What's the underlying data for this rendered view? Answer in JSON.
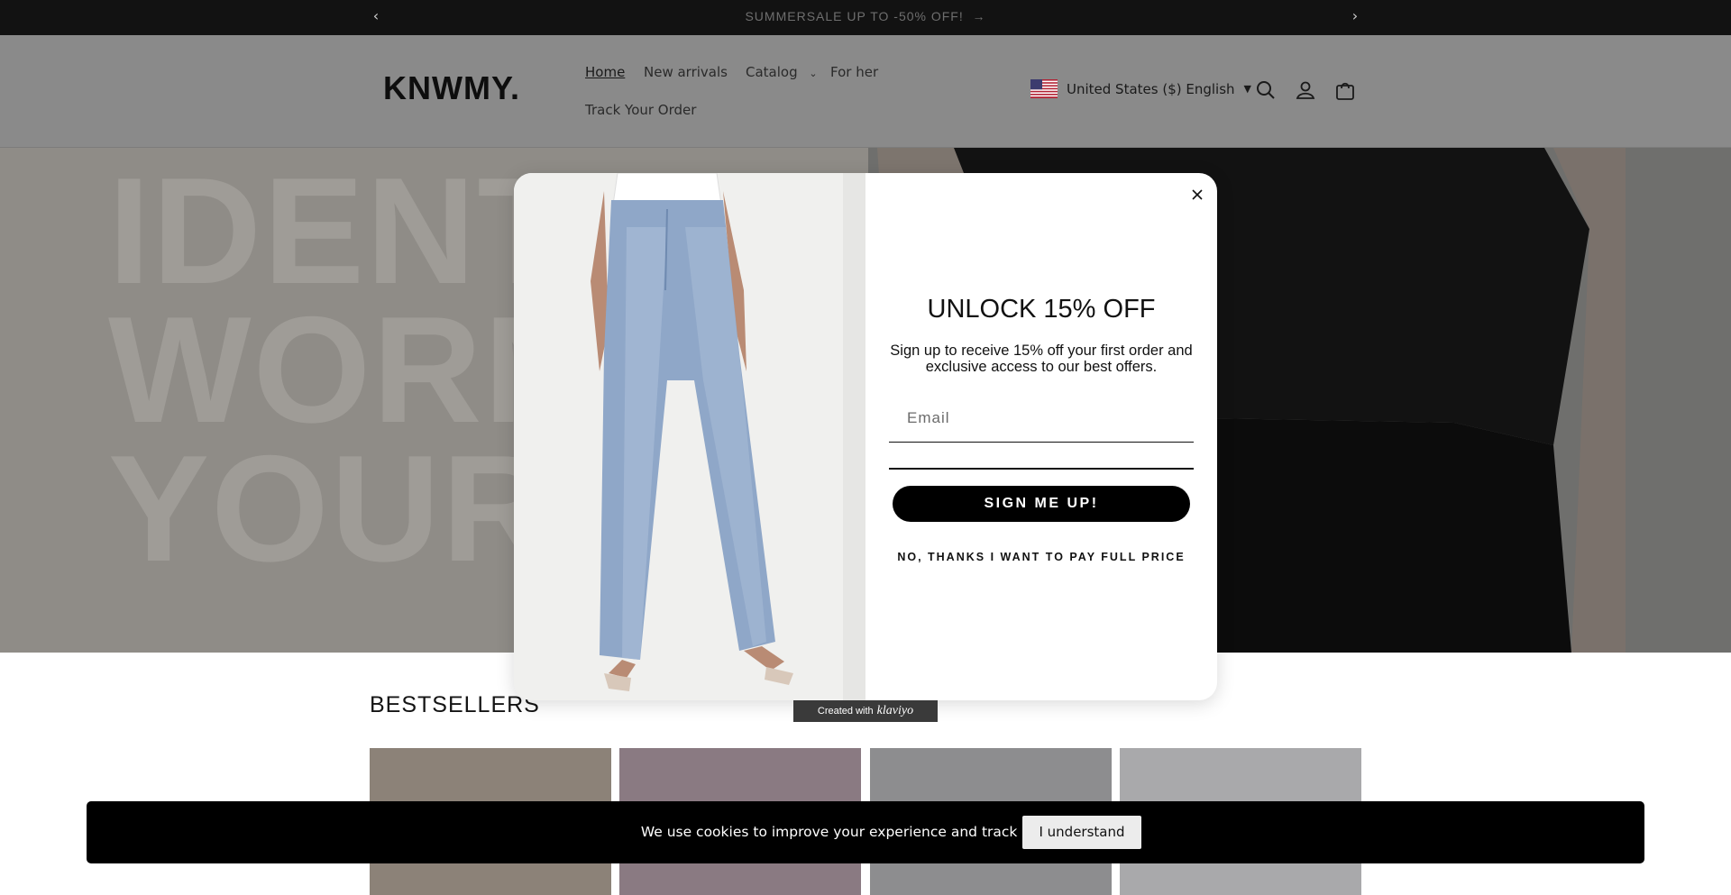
{
  "announcement": {
    "prev_icon": "chevron-left-icon",
    "text": "SUMMERSALE UP TO -50% OFF!",
    "arrow_icon": "arrow-right-icon",
    "next_icon": "chevron-right-icon"
  },
  "header": {
    "logo": "KNWMY.",
    "nav": {
      "home": "Home",
      "new_arrivals": "New arrivals",
      "catalog": "Catalog",
      "for_her": "For her",
      "track_order": "Track Your Order"
    },
    "country_selector": "United States ($) English",
    "icons": [
      "search-icon",
      "account-icon",
      "cart-icon"
    ]
  },
  "hero": {
    "slogan": [
      "IDENTI",
      "WORN",
      "YOUR V"
    ]
  },
  "modal": {
    "headline": "UNLOCK 15% OFF",
    "subtext": "Sign up to receive 15% off your first order and exclusive access to our best offers.",
    "email_placeholder": "Email",
    "submit_label": "SIGN ME UP!",
    "decline_label": "NO, THANKS I WANT TO PAY FULL PRICE"
  },
  "klaviyo": {
    "prefix": "Created with",
    "brand": "klaviyo"
  },
  "bestsellers": {
    "title": "BESTSELLERS"
  },
  "cookie": {
    "text": "We use cookies to improve your experience and track website usage.",
    "button": "I understand"
  },
  "colors": {
    "announcement_bg": "#121212",
    "header_bg": "#8a8a8a",
    "cta_bg": "#000000",
    "cookie_bg": "#000000"
  }
}
